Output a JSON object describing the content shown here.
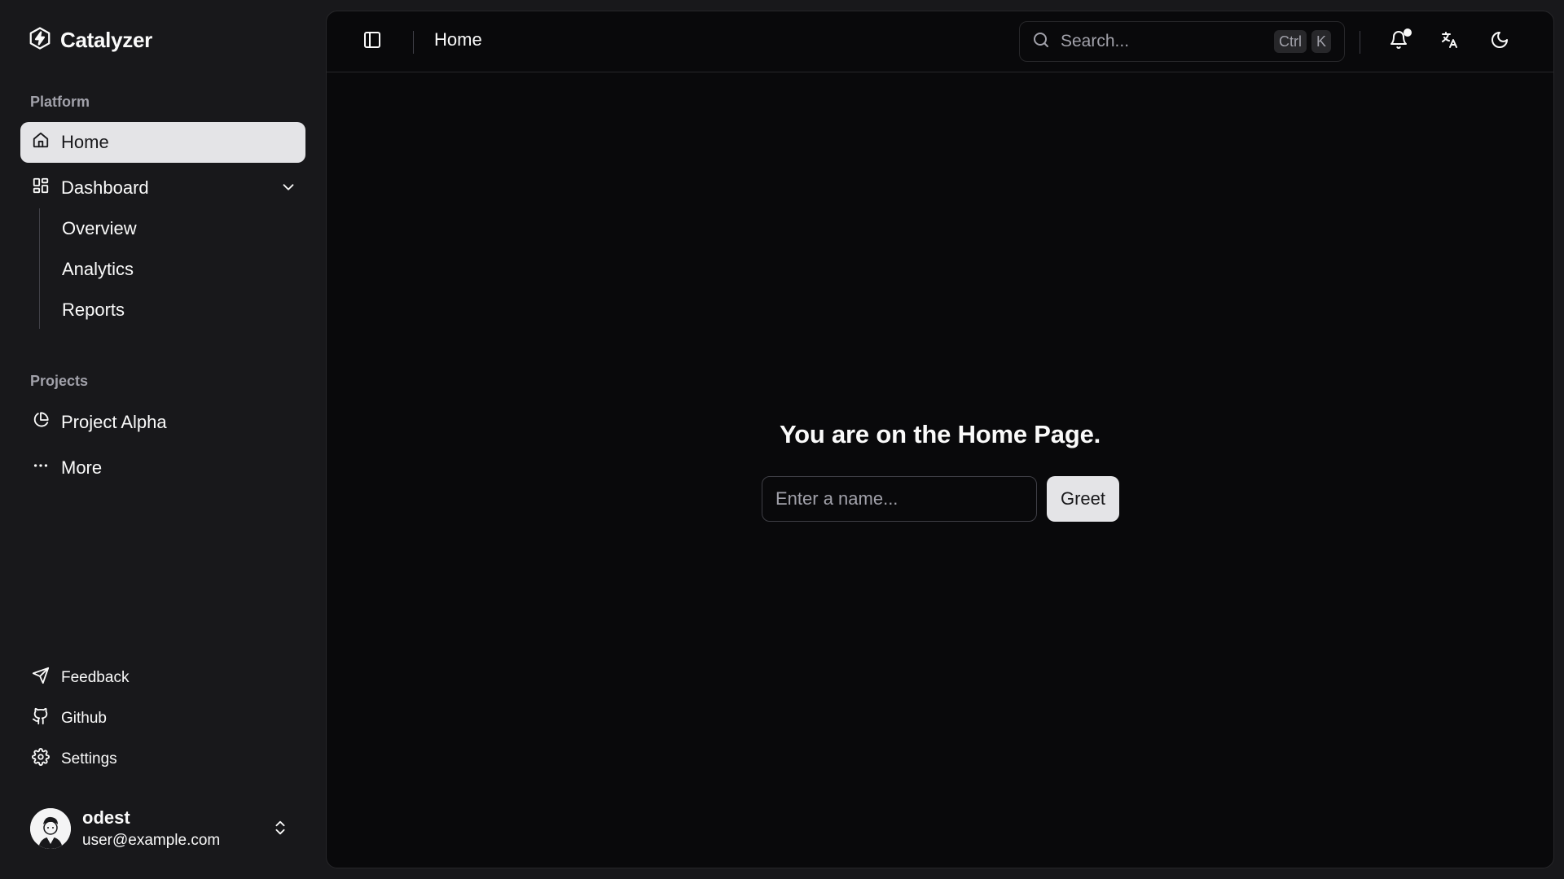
{
  "brand": {
    "name": "Catalyzer"
  },
  "sidebar": {
    "platform_label": "Platform",
    "items": [
      {
        "label": "Home",
        "icon": "home-icon",
        "active": true
      },
      {
        "label": "Dashboard",
        "icon": "dashboard-icon",
        "expanded": true
      }
    ],
    "dashboard_children": [
      {
        "label": "Overview"
      },
      {
        "label": "Analytics"
      },
      {
        "label": "Reports"
      }
    ],
    "projects_label": "Projects",
    "projects": [
      {
        "label": "Project Alpha",
        "icon": "pie-chart-icon"
      },
      {
        "label": "More",
        "icon": "ellipsis-icon"
      }
    ],
    "footer": [
      {
        "label": "Feedback",
        "icon": "send-icon"
      },
      {
        "label": "Github",
        "icon": "github-icon"
      },
      {
        "label": "Settings",
        "icon": "gear-icon"
      }
    ],
    "user": {
      "name": "odest",
      "email": "user@example.com"
    }
  },
  "header": {
    "breadcrumb": "Home",
    "search": {
      "placeholder": "Search...",
      "shortcut": [
        "Ctrl",
        "K"
      ]
    },
    "has_notification": true
  },
  "main": {
    "title": "You are on the Home Page.",
    "name_input": {
      "placeholder": "Enter a name...",
      "value": ""
    },
    "greet_label": "Greet"
  },
  "colors": {
    "sidebar_bg": "#18181b",
    "panel_bg": "#09090b",
    "active_item_bg": "#e4e4e7",
    "text": "#fafafa",
    "muted_text": "#a1a1aa",
    "border": "#27272a"
  }
}
